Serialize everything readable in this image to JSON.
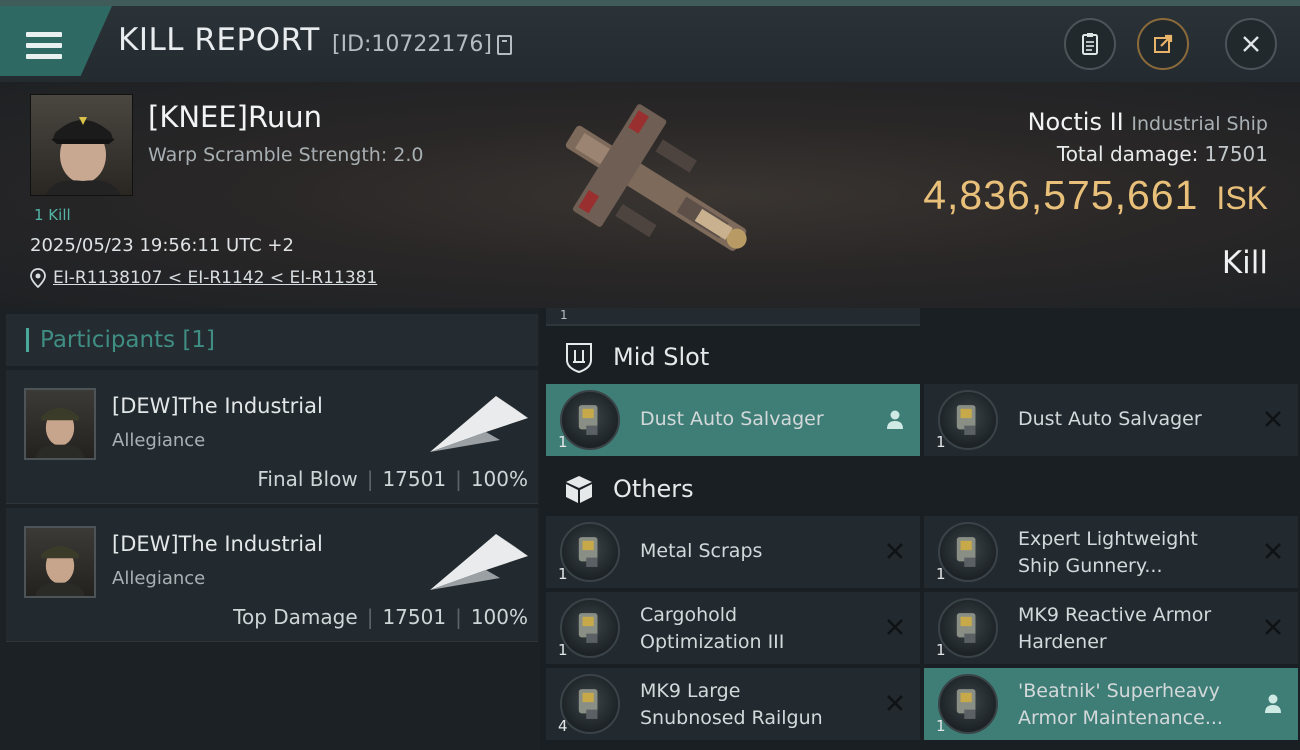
{
  "header": {
    "title": "KILL REPORT",
    "report_id": "[ID:10722176]"
  },
  "victim": {
    "name": "[KNEE]Ruun",
    "warp_scramble": "Warp Scramble Strength: 2.0",
    "kill_count": "1 Kill",
    "timestamp": "2025/05/23 19:56:11 UTC +2",
    "location": "EI-R1138107 < EI-R1142 < EI-R11381",
    "ship_name": "Noctis II",
    "ship_class": "Industrial Ship",
    "total_damage_label": "Total damage:",
    "total_damage": "17501",
    "isk_value": "4,836,575,661",
    "isk_unit": "ISK",
    "result": "Kill"
  },
  "participants": {
    "title": "Participants [1]",
    "cards": [
      {
        "name": "[DEW]The Industrial",
        "corp": "Allegiance",
        "role": "Final Blow",
        "damage": "17501",
        "percent": "100%"
      },
      {
        "name": "[DEW]The Industrial",
        "corp": "Allegiance",
        "role": "Top Damage",
        "damage": "17501",
        "percent": "100%"
      }
    ]
  },
  "modules": {
    "top_stub_qty": "1",
    "mid_slot": {
      "title": "Mid Slot",
      "items": [
        {
          "label": [
            "Dust Auto Salvager"
          ],
          "qty": "1",
          "status": "dropped"
        },
        {
          "label": [
            "Dust Auto Salvager"
          ],
          "qty": "1",
          "status": "destroyed"
        }
      ]
    },
    "others": {
      "title": "Others",
      "items": [
        {
          "label": [
            "Metal Scraps"
          ],
          "qty": "1",
          "status": "destroyed"
        },
        {
          "label": [
            "Expert Lightweight",
            "Ship Gunnery..."
          ],
          "qty": "1",
          "status": "destroyed"
        },
        {
          "label": [
            "Cargohold",
            "Optimization III"
          ],
          "qty": "1",
          "status": "destroyed"
        },
        {
          "label": [
            "MK9 Reactive Armor",
            "Hardener"
          ],
          "qty": "1",
          "status": "destroyed"
        },
        {
          "label": [
            "MK9 Large",
            "Snubnosed Railgun"
          ],
          "qty": "4",
          "status": "destroyed"
        },
        {
          "label": [
            "'Beatnik' Superheavy",
            "Armor Maintenance..."
          ],
          "qty": "1",
          "status": "dropped"
        }
      ]
    }
  },
  "colors": {
    "accent_teal": "#3f7e76",
    "isk_gold": "#e9c07a",
    "participants_teal": "#3f8d83"
  },
  "icons": [
    "menu-icon",
    "copy-icon",
    "clipboard-icon",
    "share-icon",
    "close-icon",
    "location-pin-icon",
    "mid-slot-icon",
    "others-box-icon",
    "person-icon",
    "x-icon"
  ]
}
